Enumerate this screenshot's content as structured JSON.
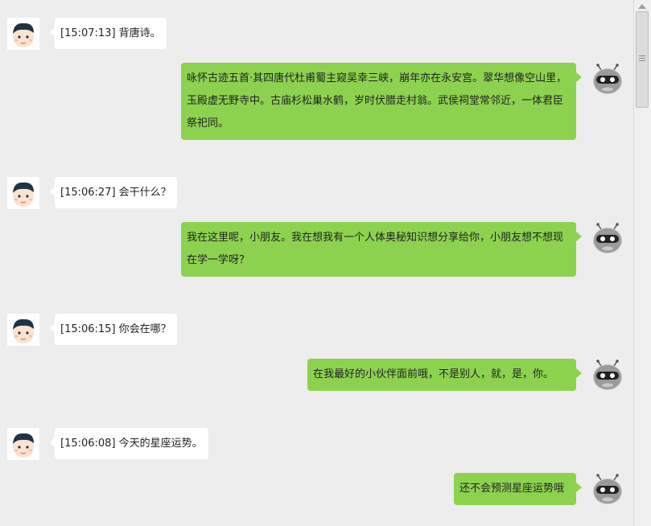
{
  "messages": [
    {
      "role": "user",
      "text": "[15:07:13] 背唐诗。"
    },
    {
      "role": "bot",
      "text": "咏怀古迹五首·其四唐代杜甫蜀主窥吴幸三峡，崩年亦在永安宫。翠华想像空山里，玉殿虚无野寺中。古庙杉松巢水鹤，岁时伏腊走村翁。武侯祠堂常邻近，一体君臣祭祀同。"
    },
    {
      "role": "user",
      "text": "[15:06:27] 会干什么？"
    },
    {
      "role": "bot",
      "text": "我在这里呢，小朋友。我在想我有一个人体奥秘知识想分享给你，小朋友想不想现在学一学呀？"
    },
    {
      "role": "user",
      "text": "[15:06:15] 你会在哪？"
    },
    {
      "role": "bot",
      "text": "在我最好的小伙伴面前哦，不是别人，就，是，你。"
    },
    {
      "role": "user",
      "text": "[15:06:08] 今天的星座运势。"
    },
    {
      "role": "bot",
      "text": "还不会预测星座运势哦"
    }
  ],
  "icons": {
    "user_avatar": "boy-avatar-icon",
    "bot_avatar": "robot-avatar-icon"
  },
  "colors": {
    "background": "#ededed",
    "user_bubble": "#ffffff",
    "bot_bubble": "#8cd24f"
  }
}
